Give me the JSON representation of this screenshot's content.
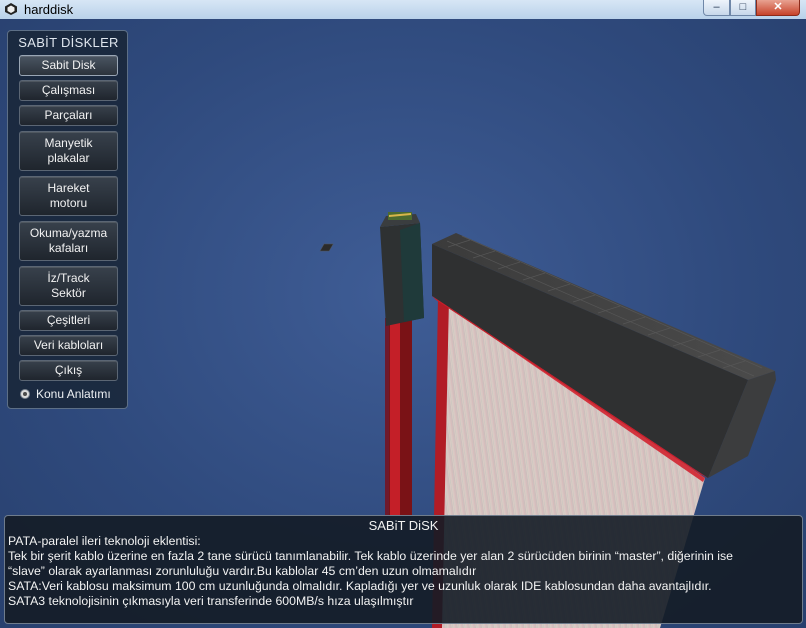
{
  "window": {
    "title": "harddisk",
    "app_icon": "unity-icon",
    "controls": {
      "minimize": "–",
      "maximize": "□",
      "close": "✕"
    }
  },
  "menu": {
    "title": "SABİT DİSKLER",
    "buttons": [
      {
        "line1": "Sabit Disk",
        "line2": ""
      },
      {
        "line1": "Çalışması",
        "line2": ""
      },
      {
        "line1": "Parçaları",
        "line2": ""
      },
      {
        "line1": "Manyetik",
        "line2": "plakalar"
      },
      {
        "line1": "Hareket",
        "line2": "motoru"
      },
      {
        "line1": "Okuma/yazma",
        "line2": "kafaları"
      },
      {
        "line1": "İz/Track",
        "line2": "Sektör"
      },
      {
        "line1": "Çeşitleri",
        "line2": ""
      },
      {
        "line1": "Veri kabloları",
        "line2": ""
      },
      {
        "line1": "Çıkış",
        "line2": ""
      }
    ],
    "toggle_label": "Konu Anlatımı"
  },
  "info": {
    "title": "SABiT DiSK",
    "lines": [
      "PATA-paralel ileri teknoloji eklentisi:",
      "Tek bir şerit kablo üzerine en fazla 2 tane sürücü tanımlanabilir. Tek kablo üzerinde yer alan 2 sürücüden birinin “master”, diğerinin ise",
      "“slave” olarak ayarlanması zorunluluğu vardır.Bu kablolar 45 cm’den uzun olmamalıdır",
      "SATA:Veri kablosu maksimum 100 cm uzunluğunda olmalıdır. Kapladığı yer ve uzunluk olarak IDE kablosundan daha avantajlıdır.",
      "SATA3 teknolojisinin çıkmasıyla veri transferinde 600MB/s hıza ulaşılmıştır"
    ]
  },
  "colors": {
    "background": "#2f4a7d",
    "connector": "#3a3a3a",
    "cable_red": "#c0202a",
    "ribbon": "#d9c7c0"
  }
}
